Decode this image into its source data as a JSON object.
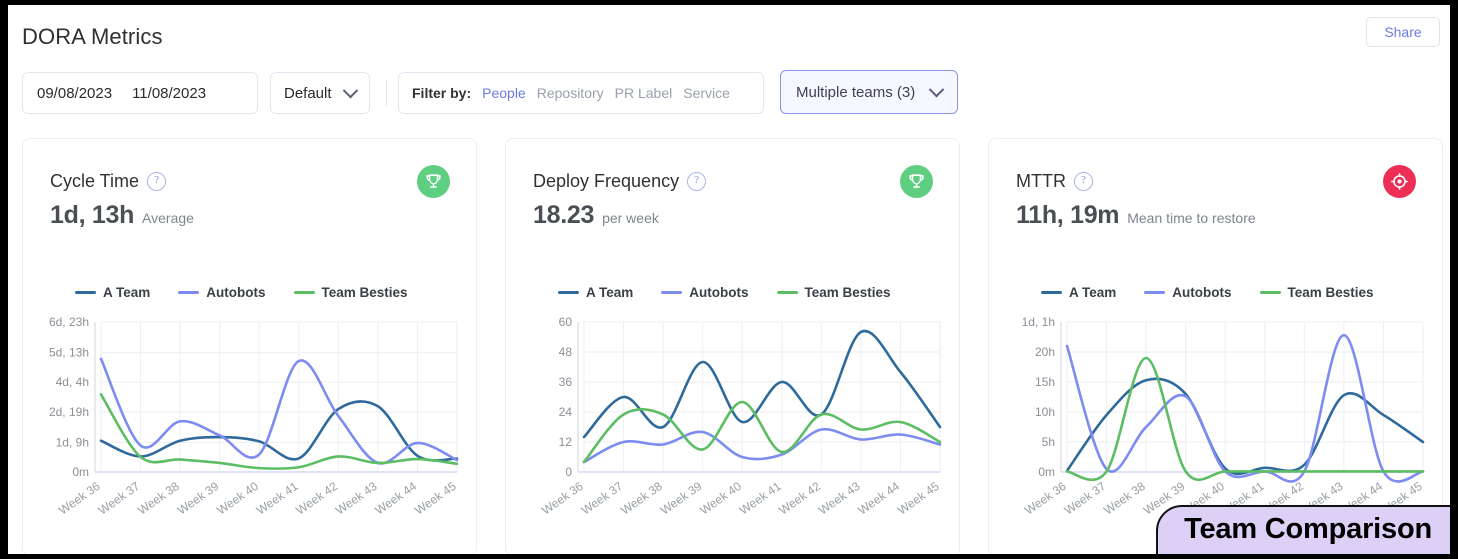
{
  "header": {
    "title": "DORA Metrics",
    "share_label": "Share"
  },
  "filters": {
    "date_from": "09/08/2023",
    "date_to": "11/08/2023",
    "preset_label": "Default",
    "filter_by_label": "Filter by:",
    "filter_options": [
      "People",
      "Repository",
      "PR Label",
      "Service"
    ],
    "active_filter": "People",
    "teams_label": "Multiple teams (3)"
  },
  "legend": [
    {
      "name": "A Team",
      "color": "#2f6a9c"
    },
    {
      "name": "Autobots",
      "color": "#7d8cf0"
    },
    {
      "name": "Team Besties",
      "color": "#5cbd63"
    }
  ],
  "overlay": {
    "callout_label": "Team Comparison",
    "callout_bg": "#ddd0f7"
  },
  "cards": [
    {
      "title": "Cycle Time",
      "kpi_value": "1d, 13h",
      "kpi_unit": "Average",
      "badge_icon": "trophy-icon",
      "badge_color": "#5ecf80"
    },
    {
      "title": "Deploy Frequency",
      "kpi_value": "18.23",
      "kpi_unit": "per week",
      "badge_icon": "trophy-icon",
      "badge_color": "#5ecf80"
    },
    {
      "title": "MTTR",
      "kpi_value": "11h, 19m",
      "kpi_unit": "Mean time to restore",
      "badge_icon": "target-icon",
      "badge_color": "#ed2e55"
    }
  ],
  "chart_data": [
    {
      "type": "line",
      "title": "Cycle Time",
      "xlabel": "",
      "ylabel": "",
      "categories": [
        "Week 36",
        "Week 37",
        "Week 38",
        "Week 39",
        "Week 40",
        "Week 41",
        "Week 42",
        "Week 43",
        "Week 44",
        "Week 45"
      ],
      "ytick_labels": [
        "0m",
        "1d, 9h",
        "2d, 19h",
        "4d, 4h",
        "5d, 13h",
        "6d, 23h"
      ],
      "ytick_values": [
        0,
        1.375,
        2.79,
        4.17,
        5.54,
        6.96
      ],
      "ylim": [
        0,
        6.96
      ],
      "grid": true,
      "legend_position": "top-left",
      "series": [
        {
          "name": "A Team",
          "color": "#2f6a9c",
          "values": [
            1.45,
            0.72,
            1.45,
            1.62,
            1.42,
            0.63,
            2.92,
            3.05,
            0.75,
            0.62
          ]
        },
        {
          "name": "Autobots",
          "color": "#7d8cf0",
          "values": [
            5.25,
            1.23,
            2.35,
            1.7,
            0.82,
            5.15,
            2.6,
            0.42,
            1.35,
            0.55
          ]
        },
        {
          "name": "Team Besties",
          "color": "#5cbd63",
          "values": [
            3.6,
            0.7,
            0.58,
            0.42,
            0.18,
            0.22,
            0.72,
            0.42,
            0.6,
            0.38
          ]
        }
      ]
    },
    {
      "type": "line",
      "title": "Deploy Frequency",
      "xlabel": "",
      "ylabel": "",
      "categories": [
        "Week 36",
        "Week 37",
        "Week 38",
        "Week 39",
        "Week 40",
        "Week 41",
        "Week 42",
        "Week 43",
        "Week 44",
        "Week 45"
      ],
      "ytick_labels": [
        "0",
        "12",
        "24",
        "36",
        "48",
        "60"
      ],
      "ytick_values": [
        0,
        12,
        24,
        36,
        48,
        60
      ],
      "ylim": [
        0,
        60
      ],
      "grid": true,
      "legend_position": "top-left",
      "series": [
        {
          "name": "A Team",
          "color": "#2f6a9c",
          "values": [
            14,
            30,
            18,
            44,
            20,
            36,
            23,
            56,
            40,
            18
          ]
        },
        {
          "name": "Autobots",
          "color": "#7d8cf0",
          "values": [
            4,
            12,
            11,
            16,
            6,
            7,
            17,
            13,
            15,
            11
          ]
        },
        {
          "name": "Team Besties",
          "color": "#5cbd63",
          "values": [
            4,
            23,
            23,
            9,
            28,
            8,
            23,
            17,
            20,
            12
          ]
        }
      ]
    },
    {
      "type": "line",
      "title": "MTTR",
      "xlabel": "",
      "ylabel": "",
      "categories": [
        "Week 36",
        "Week 37",
        "Week 38",
        "Week 39",
        "Week 40",
        "Week 41",
        "Week 42",
        "Week 43",
        "Week 44",
        "Week 45"
      ],
      "ytick_labels": [
        "0m",
        "5h",
        "10h",
        "15h",
        "20h",
        "1d, 1h"
      ],
      "ytick_values": [
        0,
        5,
        10,
        15,
        20,
        25
      ],
      "ylim": [
        0,
        25
      ],
      "grid": true,
      "legend_position": "top-left",
      "series": [
        {
          "name": "A Team",
          "color": "#2f6a9c",
          "values": [
            0.2,
            9.5,
            15.3,
            13.0,
            0.6,
            0.7,
            1.2,
            12.8,
            9.5,
            5.0
          ]
        },
        {
          "name": "Autobots",
          "color": "#7d8cf0",
          "values": [
            21.0,
            0.5,
            7.5,
            12.6,
            0.1,
            0.1,
            0.1,
            22.8,
            0.1,
            0.1
          ]
        },
        {
          "name": "Team Besties",
          "color": "#5cbd63",
          "values": [
            0.1,
            0.1,
            19.0,
            0.1,
            0.1,
            0.1,
            0.1,
            0.1,
            0.1,
            0.1
          ]
        }
      ]
    }
  ]
}
